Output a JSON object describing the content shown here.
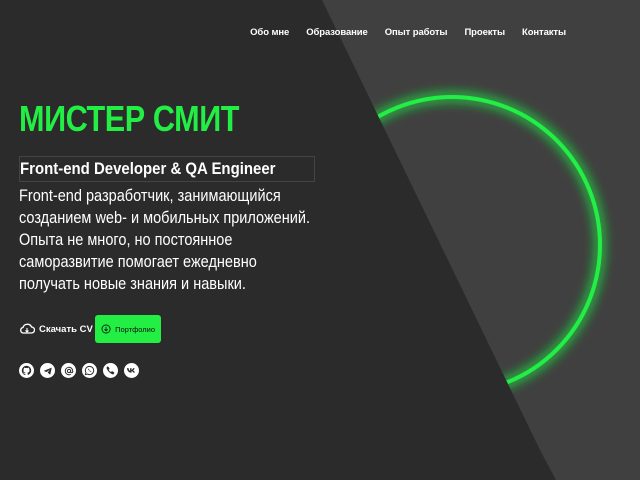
{
  "nav": {
    "items": [
      {
        "label": "Обо мне"
      },
      {
        "label": "Образование"
      },
      {
        "label": "Опыт работы"
      },
      {
        "label": "Проекты"
      },
      {
        "label": "Контакты"
      }
    ]
  },
  "hero": {
    "name": "МИСТЕР СМИТ",
    "role": "Front-end Developer & QA Engineer",
    "description_lines": [
      "Front-end разработчик, занимающийся",
      "созданием web- и мобильных приложений.",
      "Опыта не много, но постоянное",
      "саморазвитие помогает ежедневно",
      "получать новые знания и навыки."
    ]
  },
  "actions": {
    "cv_label": "Скачать CV",
    "portfolio_label": "Портфолио"
  },
  "socials": [
    {
      "icon": "github-icon"
    },
    {
      "icon": "telegram-icon"
    },
    {
      "icon": "email-icon"
    },
    {
      "icon": "whatsapp-icon"
    },
    {
      "icon": "viber-icon"
    },
    {
      "icon": "vk-icon"
    }
  ],
  "colors": {
    "accent": "#22ee44",
    "background": "#2b2b2b",
    "panel": "#404040"
  }
}
